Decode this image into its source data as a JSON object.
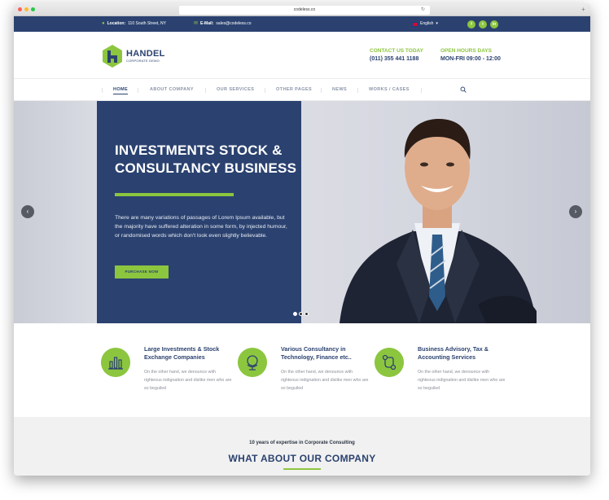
{
  "browser": {
    "url": "codeless.co"
  },
  "topbar": {
    "location_label": "Location:",
    "location_value": "110 South Street, NY",
    "email_label": "E-Mail:",
    "email_value": "sales@codeless.co",
    "language": "English",
    "social": [
      "f",
      "t",
      "in"
    ]
  },
  "header": {
    "logo_name": "HANDEL",
    "logo_sub": "CORPORATE DEMO",
    "contact_label": "CONTACT US TODAY",
    "contact_value": "(011) 355 441 1188",
    "hours_label": "OPEN HOURS DAYS",
    "hours_value": "MON-FRI 09:00 - 12:00"
  },
  "nav": {
    "items": [
      "HOME",
      "ABOUT COMPANY",
      "OUR SERVICES",
      "OTHER PAGES",
      "NEWS",
      "WORKS / CASES"
    ]
  },
  "hero": {
    "title": "INVESTMENTS STOCK & CONSULTANCY BUSINESS",
    "text": "There are many variations of passages of Lorem Ipsum available, but the majority have suffered alteration in some form, by injected humour, or randomised words which don't look even slightly believable.",
    "button": "PURCHASE NOW"
  },
  "features": [
    {
      "title": "Large Investments & Stock Exchange Companies",
      "text": "On the other hand, we denounce with righteous indignation and dislike men who are so beguiled",
      "icon": "chart-icon"
    },
    {
      "title": "Various Consultancy in Technology, Finance etc..",
      "text": "On the other hand, we denounce with righteous indignation and dislike men who are so beguiled",
      "icon": "globe-icon"
    },
    {
      "title": "Business Advisory, Tax & Accounting Services",
      "text": "On the other hand, we denounce with righteous indignation and dislike men who are so beguiled",
      "icon": "flow-icon"
    }
  ],
  "about": {
    "subtitle": "10 years of expertise in Corporate Consulting",
    "title": "WHAT ABOUT OUR COMPANY"
  },
  "colors": {
    "navy": "#2b4270",
    "green": "#8cc63f"
  }
}
